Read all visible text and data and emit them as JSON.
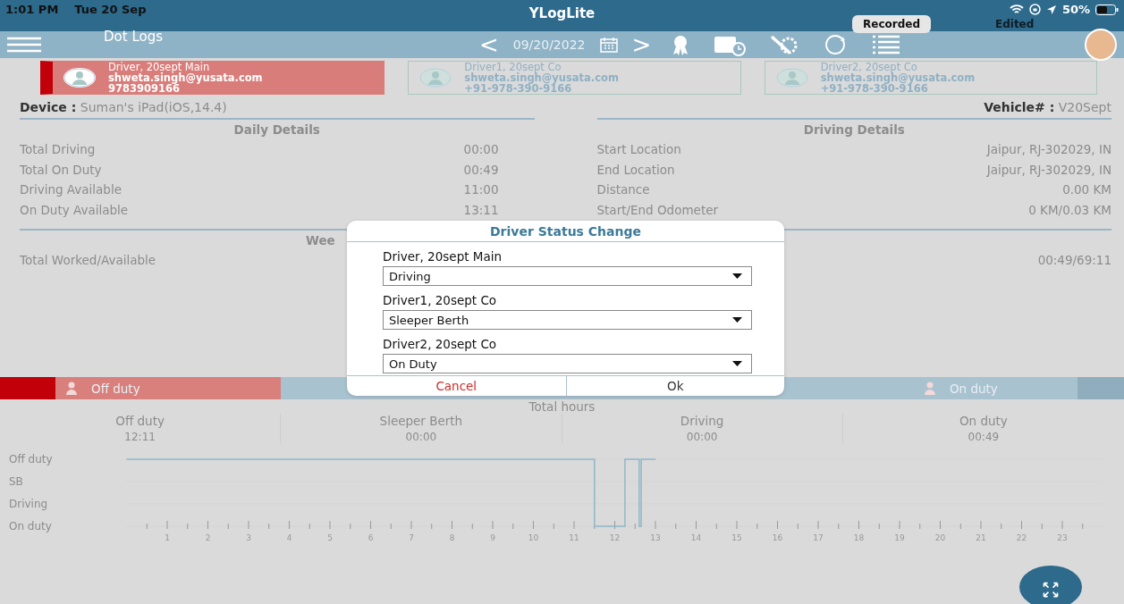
{
  "status_bar": {
    "time": "1:01 PM",
    "date": "Tue 20 Sep",
    "battery": "50%"
  },
  "app_title": "YLogLite",
  "toolbar": {
    "title": "Dot Logs",
    "prev": "<",
    "date": "09/20/2022",
    "next": ">"
  },
  "log_tabs": [
    {
      "label": "Recorded",
      "selected": true
    },
    {
      "label": "Edited",
      "selected": false
    }
  ],
  "drivers": [
    {
      "name": "Driver, 20sept Main",
      "email": "shweta.singh@yusata.com",
      "phone": "9783909166",
      "selected": true
    },
    {
      "name": "Driver1, 20sept Co",
      "email": "shweta.singh@yusata.com",
      "phone": "+91-978-390-9166",
      "selected": false
    },
    {
      "name": "Driver2, 20sept Co",
      "email": "shweta.singh@yusata.com",
      "phone": "+91-978-390-9166",
      "selected": false
    }
  ],
  "device": {
    "label": "Device :",
    "value": "Suman's iPad(iOS,14.4)"
  },
  "vehicle": {
    "label": "Vehicle# :",
    "value": "V20Sept"
  },
  "daily_details": {
    "title": "Daily Details",
    "rows": [
      {
        "label": "Total Driving",
        "value": "00:00"
      },
      {
        "label": "Total On Duty",
        "value": "00:49"
      },
      {
        "label": "Driving Available",
        "value": "11:00"
      },
      {
        "label": "On Duty Available",
        "value": "13:11"
      }
    ]
  },
  "driving_details": {
    "title": "Driving Details",
    "rows": [
      {
        "label": "Start Location",
        "value": "Jaipur, RJ-302029, IN"
      },
      {
        "label": "End Location",
        "value": "Jaipur, RJ-302029, IN"
      },
      {
        "label": "Distance",
        "value": "0.00 KM"
      },
      {
        "label": "Start/End Odometer",
        "value": "0 KM/0.03 KM"
      }
    ]
  },
  "weekly": {
    "title": "Wee",
    "label": "Total Worked/Available",
    "value": "00:49/69:11"
  },
  "duty_tabs": [
    {
      "label": "Off duty",
      "selected": true
    },
    {
      "selected": false
    },
    {
      "selected": false
    },
    {
      "label": "On duty",
      "selected": false
    }
  ],
  "total_hours": {
    "title": "Total hours",
    "columns": [
      {
        "label": "Off duty",
        "value": "12:11"
      },
      {
        "label": "Sleeper Berth",
        "value": "00:00"
      },
      {
        "label": "Driving",
        "value": "00:00"
      },
      {
        "label": "On duty",
        "value": "00:49"
      }
    ]
  },
  "log_graph": {
    "row_labels": [
      "Off duty",
      "SB",
      "Driving",
      "On duty"
    ],
    "hour_labels": [
      "1",
      "2",
      "3",
      "4",
      "5",
      "6",
      "7",
      "8",
      "9",
      "10",
      "11",
      "12",
      "13",
      "14",
      "15",
      "16",
      "17",
      "18",
      "19",
      "20",
      "21",
      "22",
      "23"
    ]
  },
  "dialog": {
    "title": "Driver Status Change",
    "fields": [
      {
        "label": "Driver, 20sept Main",
        "value": "Driving"
      },
      {
        "label": "Driver1, 20sept Co",
        "value": "Sleeper Berth"
      },
      {
        "label": "Driver2, 20sept Co",
        "value": "On Duty"
      }
    ],
    "buttons": [
      {
        "label": "Cancel",
        "kind": "cancel"
      },
      {
        "label": "Ok",
        "kind": "ok"
      }
    ]
  }
}
